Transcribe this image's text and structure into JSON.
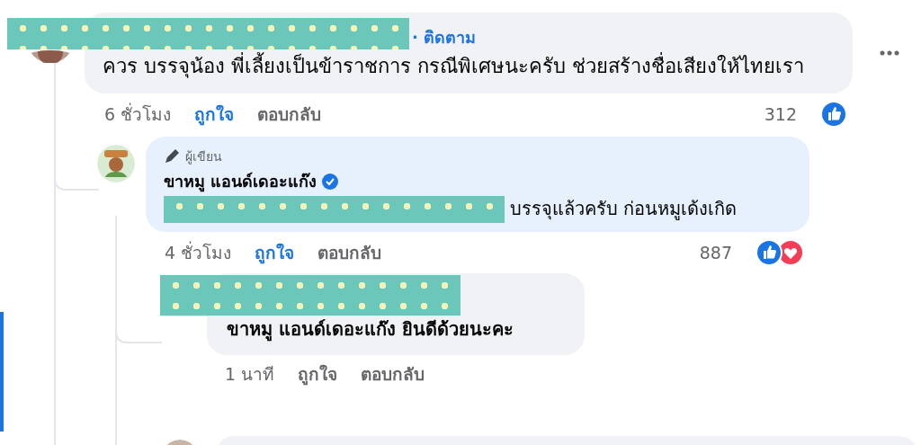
{
  "comments": [
    {
      "kind": "top",
      "redacted_name": true,
      "follow": "· ติดตาม",
      "text": "ควร บรรจุน้อง พี่เลี้ยงเป็นข้าราชการ กรณีพิเศษนะครับ ช่วยสร้างชื่อเสียงให้ไทยเรา",
      "time": "6 ชั่วโมง",
      "like": {
        "label": "ถูกใจ",
        "selected": true
      },
      "reply": "ตอบกลับ",
      "count": "312",
      "reactions": [
        {
          "kind": "like"
        }
      ]
    },
    {
      "kind": "author",
      "badge": "ผู้เขียน",
      "name": "ขาหมู แอนด์เดอะแก๊ง",
      "verified": true,
      "redacted_mention": true,
      "text": "บรรจุแล้วครับ ก่อนหมูเด้งเกิด",
      "time": "4 ชั่วโมง",
      "like": {
        "label": "ถูกใจ",
        "selected": true
      },
      "reply": "ตอบกลับ",
      "count": "887",
      "reactions": [
        {
          "kind": "like"
        },
        {
          "kind": "love"
        }
      ]
    },
    {
      "kind": "reply",
      "redacted_name": true,
      "text": "ขาหมู แอนด์เดอะแก๊ง ยินดีด้วยนะคะ",
      "time": "1 นาที",
      "like": {
        "label": "ถูกใจ",
        "selected": false
      },
      "reply": "ตอบกลับ"
    }
  ]
}
